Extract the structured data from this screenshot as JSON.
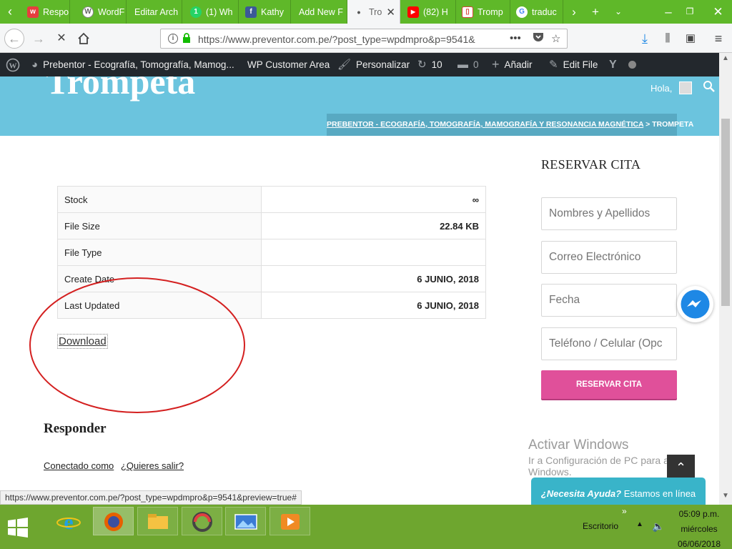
{
  "browser": {
    "tabs": [
      {
        "label": "Respo",
        "icon": "w-icon",
        "color": "#e63e3e"
      },
      {
        "label": "WordF",
        "icon": "wordpress-icon",
        "color": "#6a6a6a"
      },
      {
        "label": "Editar Arch",
        "icon": "",
        "color": ""
      },
      {
        "label": "(1) Wh",
        "icon": "whatsapp-icon",
        "color": "#25d366"
      },
      {
        "label": "Kathy",
        "icon": "facebook-icon",
        "color": "#3b5998"
      },
      {
        "label": "Add New F",
        "icon": "",
        "color": ""
      },
      {
        "label": "Tro",
        "icon": "loading-dot-icon",
        "color": "#555555"
      },
      {
        "label": "(82) H",
        "icon": "youtube-icon",
        "color": "#ff0000"
      },
      {
        "label": "Tromp",
        "icon": "doc-icon",
        "color": "#d9443a"
      },
      {
        "label": "traduc",
        "icon": "google-icon",
        "color": "#4285f4"
      }
    ],
    "url": "https://www.preventor.com.pe/?post_type=wpdmpro&p=9541&",
    "status_link": "https://www.preventor.com.pe/?post_type=wpdmpro&p=9541&preview=true#"
  },
  "wp_admin_bar": {
    "site_name": "Prebentor - Ecografía, Tomografía, Mamog...",
    "customer_area": "WP Customer Area",
    "customize": "Personalizar",
    "updates_count": "10",
    "comments_count": "0",
    "add_new": "Añadir",
    "edit_file": "Edit File"
  },
  "header": {
    "site_title": "Trompeta",
    "greeting": "Hola,",
    "breadcrumb_home": "PREBENTOR - ECOGRAFÍA, TOMOGRAFÍA, MAMOGRAFÍA Y RESONANCIA MAGNÉTICA",
    "breadcrumb_sep": ">",
    "breadcrumb_current": "TROMPETA"
  },
  "file_info": {
    "rows": [
      {
        "label": "Stock",
        "value": "∞"
      },
      {
        "label": "File Size",
        "value": "22.84 KB"
      },
      {
        "label": "File Type",
        "value": ""
      },
      {
        "label": "Create Date",
        "value": "6 JUNIO, 2018"
      },
      {
        "label": "Last Updated",
        "value": "6 JUNIO, 2018"
      }
    ],
    "download_label": "Download"
  },
  "reply": {
    "heading": "Responder",
    "logged_in_as": "Conectado como",
    "logout": "¿Quieres salir?"
  },
  "sidebar": {
    "title": "RESERVAR CITA",
    "fields": {
      "name_placeholder": "Nombres y Apellidos",
      "email_placeholder": "Correo Electrónico",
      "date_placeholder": "Fecha",
      "phone_placeholder": "Teléfono / Celular (Opc"
    },
    "submit_label": "RESERVAR CITA"
  },
  "windows_watermark": {
    "line1": "Activar Windows",
    "line2": "Ir a Configuración de PC para activar",
    "line3": "Windows."
  },
  "help_widget": {
    "bold": "¿Necesita Ayuda?",
    "text": "Estamos en línea"
  },
  "taskbar": {
    "tray_label": "Escritorio",
    "time": "05:09 p.m.",
    "day": "miércoles",
    "date": "06/06/2018"
  },
  "colors": {
    "tab_bar": "#5fb829",
    "header": "#6bc4de",
    "accent_pink": "#e0509a",
    "help_widget": "#39b4c9",
    "taskbar": "#6ea62f"
  }
}
